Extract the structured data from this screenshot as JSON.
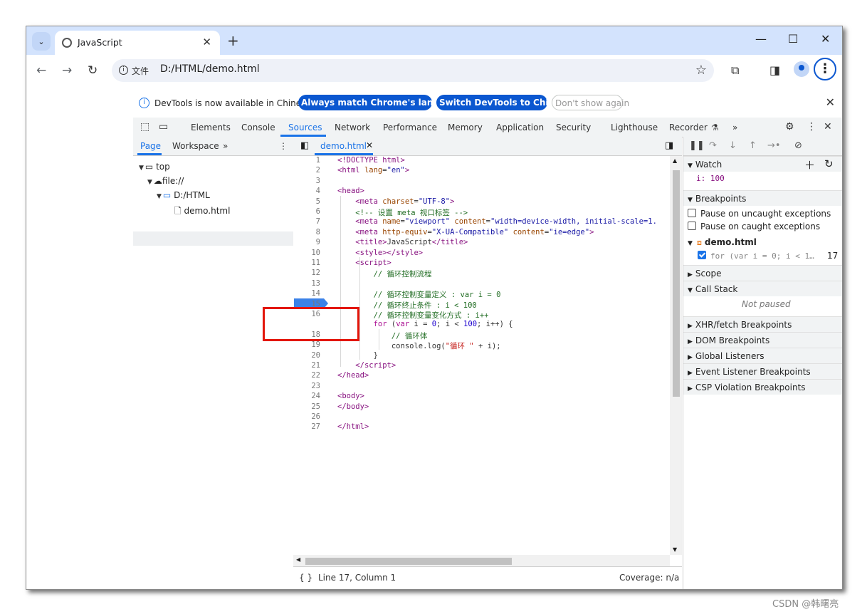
{
  "browser": {
    "tab_title": "JavaScript",
    "new_tab_label": "+",
    "url_scheme_label": "文件",
    "url": "D:/HTML/demo.html"
  },
  "devtools": {
    "infobar": {
      "message": "DevTools is now available in Chinese!",
      "btn_match": "Always match Chrome's language",
      "btn_switch": "Switch DevTools to Chinese",
      "btn_dont_show": "Don't show again"
    },
    "tabs": [
      "Elements",
      "Console",
      "Sources",
      "Network",
      "Performance",
      "Memory",
      "Application",
      "Security",
      "Lighthouse",
      "Recorder"
    ],
    "active_tab": "Sources",
    "navigator": {
      "tabs": [
        "Page",
        "Workspace"
      ],
      "tree": [
        "top",
        "file://",
        "D:/HTML",
        "demo.html"
      ]
    },
    "editor": {
      "file_tab": "demo.html",
      "status": "Line 17, Column 1",
      "coverage": "Coverage: n/a",
      "breakpoint_line": "17"
    },
    "debugger": {
      "watch_title": "Watch",
      "watch_expr": "i: 100",
      "breakpoints_title": "Breakpoints",
      "pause_uncaught": "Pause on uncaught exceptions",
      "pause_caught": "Pause on caught exceptions",
      "bp_file": "demo.html",
      "bp_code": "for (var i = 0; i < 1…",
      "bp_line": "17",
      "scope_title": "Scope",
      "callstack_title": "Call Stack",
      "not_paused": "Not paused",
      "sections": [
        "XHR/fetch Breakpoints",
        "DOM Breakpoints",
        "Global Listeners",
        "Event Listener Breakpoints",
        "CSP Violation Breakpoints"
      ]
    }
  },
  "watermark": "CSDN @韩曙亮",
  "colors": {
    "accent": "#1a73e8",
    "tabstrip": "#d3e3fd",
    "highlight_box": "#e3160b"
  }
}
